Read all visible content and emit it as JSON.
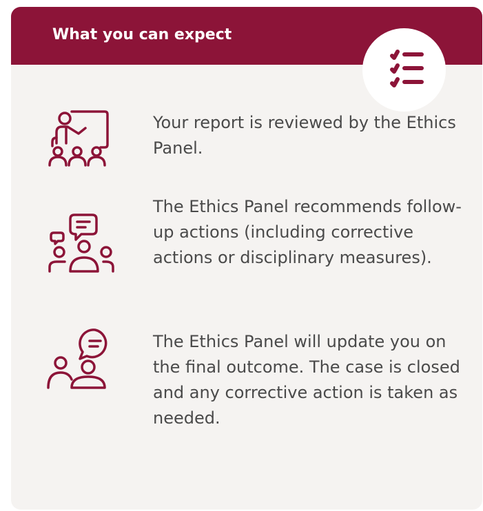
{
  "header": {
    "title": "What you can expect",
    "badge_icon": "checklist-icon"
  },
  "colors": {
    "accent": "#8c1438",
    "card_background": "#f5f3f1",
    "text": "#4a4a4a"
  },
  "steps": [
    {
      "icon": "presentation-audience-icon",
      "text": "Your report is reviewed by the Ethics Panel."
    },
    {
      "icon": "group-discussion-icon",
      "text": "The Ethics Panel recommends follow-up actions (including corrective actions or disciplinary measures)."
    },
    {
      "icon": "conversation-icon",
      "text": "The Ethics Panel will update you on the final outcome. The case is closed and any corrective action is taken as needed."
    }
  ]
}
